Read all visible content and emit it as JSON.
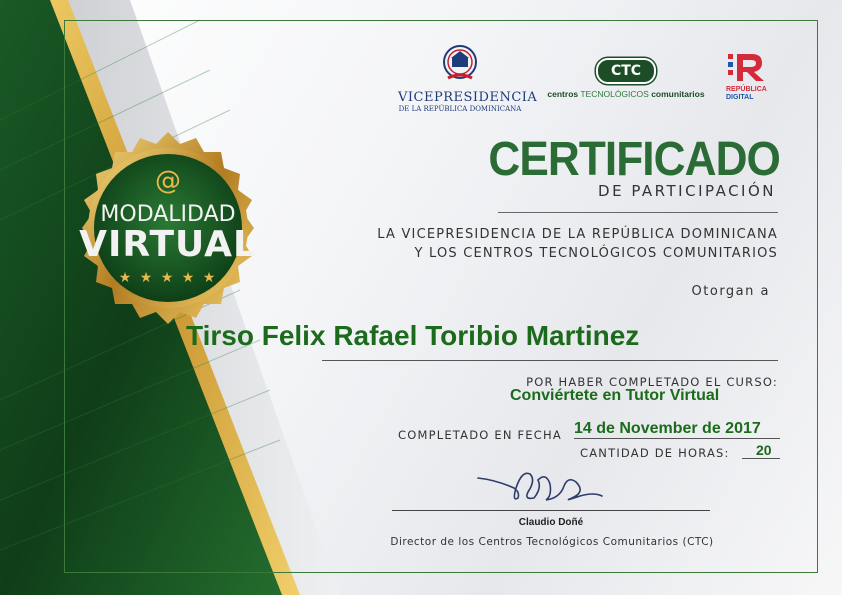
{
  "logos": {
    "vicepresidencia": {
      "name": "VICEPRESIDENCIA",
      "subtitle": "DE LA REPÚBLICA DOMINICANA"
    },
    "ctc": {
      "badge": "CTC",
      "line_a": "centros",
      "line_b": "TECNOLÓGICOS",
      "line_c": "comunitarios"
    },
    "republica_digital": {
      "line1": "REPÚBLICA",
      "line2": "DIGITAL"
    }
  },
  "seal": {
    "at": "@",
    "line1": "MODALIDAD",
    "line2": "VIRTUAL",
    "stars": "★ ★ ★ ★ ★"
  },
  "certificate": {
    "title": "CERTIFICADO",
    "subtitle": "DE PARTICIPACIÓN",
    "issuer_line1": "LA VICEPRESIDENCIA DE LA REPÚBLICA DOMINICANA",
    "issuer_line2": "Y LOS CENTROS TECNOLÓGICOS COMUNITARIOS",
    "granted": "Otorgan  a",
    "recipient": "Tirso Felix Rafael Toribio Martinez",
    "course_label": "POR HABER COMPLETADO EL CURSO:",
    "course": "Conviértete en Tutor Virtual",
    "date_label": "COMPLETADO EN FECHA",
    "date": "14 de November de 2017",
    "hours_label": "CANTIDAD DE HORAS:",
    "hours": "20"
  },
  "signatory": {
    "name": "Claudio Doñé",
    "title": "Director de los Centros Tecnológicos Comunitarios (CTC)"
  },
  "colors": {
    "green": "#1c6b1c",
    "dark_green": "#1c4d27",
    "gold": "#e6b94a",
    "blue": "#1f3c7a",
    "red": "#d42b3c"
  }
}
